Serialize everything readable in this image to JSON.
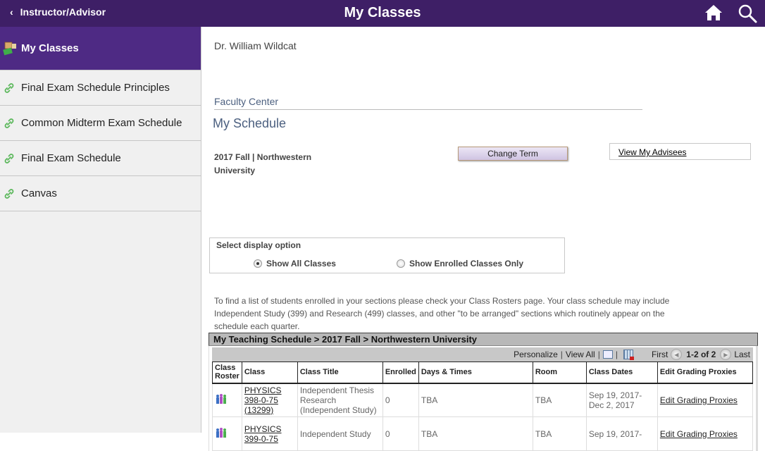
{
  "header": {
    "back_label": "Instructor/Advisor",
    "title": "My Classes",
    "home_icon": "home-icon",
    "search_icon": "search-icon"
  },
  "sidebar": {
    "active": {
      "label": "My Classes",
      "icon": "my-classes-icon"
    },
    "items": [
      {
        "label": "Final Exam Schedule Principles",
        "icon": "link-icon"
      },
      {
        "label": "Common Midterm Exam Schedule",
        "icon": "link-icon"
      },
      {
        "label": "Final Exam Schedule",
        "icon": "link-icon"
      },
      {
        "label": "Canvas",
        "icon": "link-icon"
      }
    ]
  },
  "main": {
    "user_name": "Dr. William Wildcat",
    "section_title": "Faculty Center",
    "page_title": "My Schedule",
    "term": "2017 Fall | Northwestern University",
    "change_term_label": "Change Term",
    "view_advisees_label": "View My Advisees",
    "display_option": {
      "label": "Select display option",
      "options": [
        {
          "label": "Show All Classes",
          "selected": true
        },
        {
          "label": "Show Enrolled Classes Only",
          "selected": false
        }
      ]
    },
    "info_text": "To find a list of students enrolled in your sections please check your Class Rosters page. Your class schedule may include Independent Study (399) and Research (499) classes, and other \"to be arranged\" sections which routinely appear on the schedule each quarter.",
    "grid": {
      "title": "My Teaching Schedule > 2017 Fall > Northwestern University",
      "nav": {
        "personalize": "Personalize",
        "view_all": "View All",
        "first": "First",
        "count": "1-2 of 2",
        "last": "Last"
      },
      "columns": [
        "Class Roster",
        "Class",
        "Class Title",
        "Enrolled",
        "Days & Times",
        "Room",
        "Class Dates",
        "Edit Grading Proxies"
      ],
      "rows": [
        {
          "class": "PHYSICS 398-0-75 (13299)",
          "title": "Independent Thesis Research (Independent Study)",
          "enrolled": "0",
          "days_times": "TBA",
          "room": "TBA",
          "dates": "Sep 19, 2017- Dec 2, 2017",
          "proxies": "Edit Grading Proxies"
        },
        {
          "class": "PHYSICS 399-0-75",
          "title": "Independent Study",
          "enrolled": "0",
          "days_times": "TBA",
          "room": "TBA",
          "dates": "Sep 19, 2017-",
          "proxies": "Edit Grading Proxies"
        }
      ]
    }
  }
}
